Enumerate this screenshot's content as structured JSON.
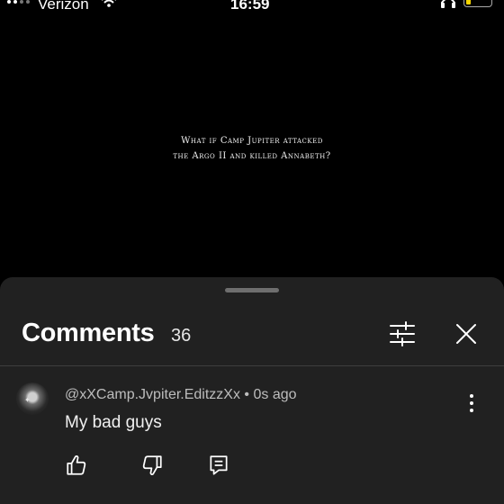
{
  "status_bar": {
    "carrier": "Verizon",
    "time": "16:59"
  },
  "video": {
    "caption_line1": "What if Camp Jupiter attacked",
    "caption_line2": "the Argo II and killed Annabeth?"
  },
  "comments_sheet": {
    "title": "Comments",
    "count": "36",
    "filter_icon": "sliders-icon",
    "close_icon": "close-icon"
  },
  "comment": {
    "author": "@xXCamp.Jvpiter.EditzzXx",
    "separator": "•",
    "time": "0s ago",
    "text": "My bad guys",
    "actions": [
      "like-icon",
      "dislike-icon",
      "reply-icon"
    ]
  },
  "colors": {
    "sheet_bg": "#212121",
    "battery": "#f5d400"
  }
}
